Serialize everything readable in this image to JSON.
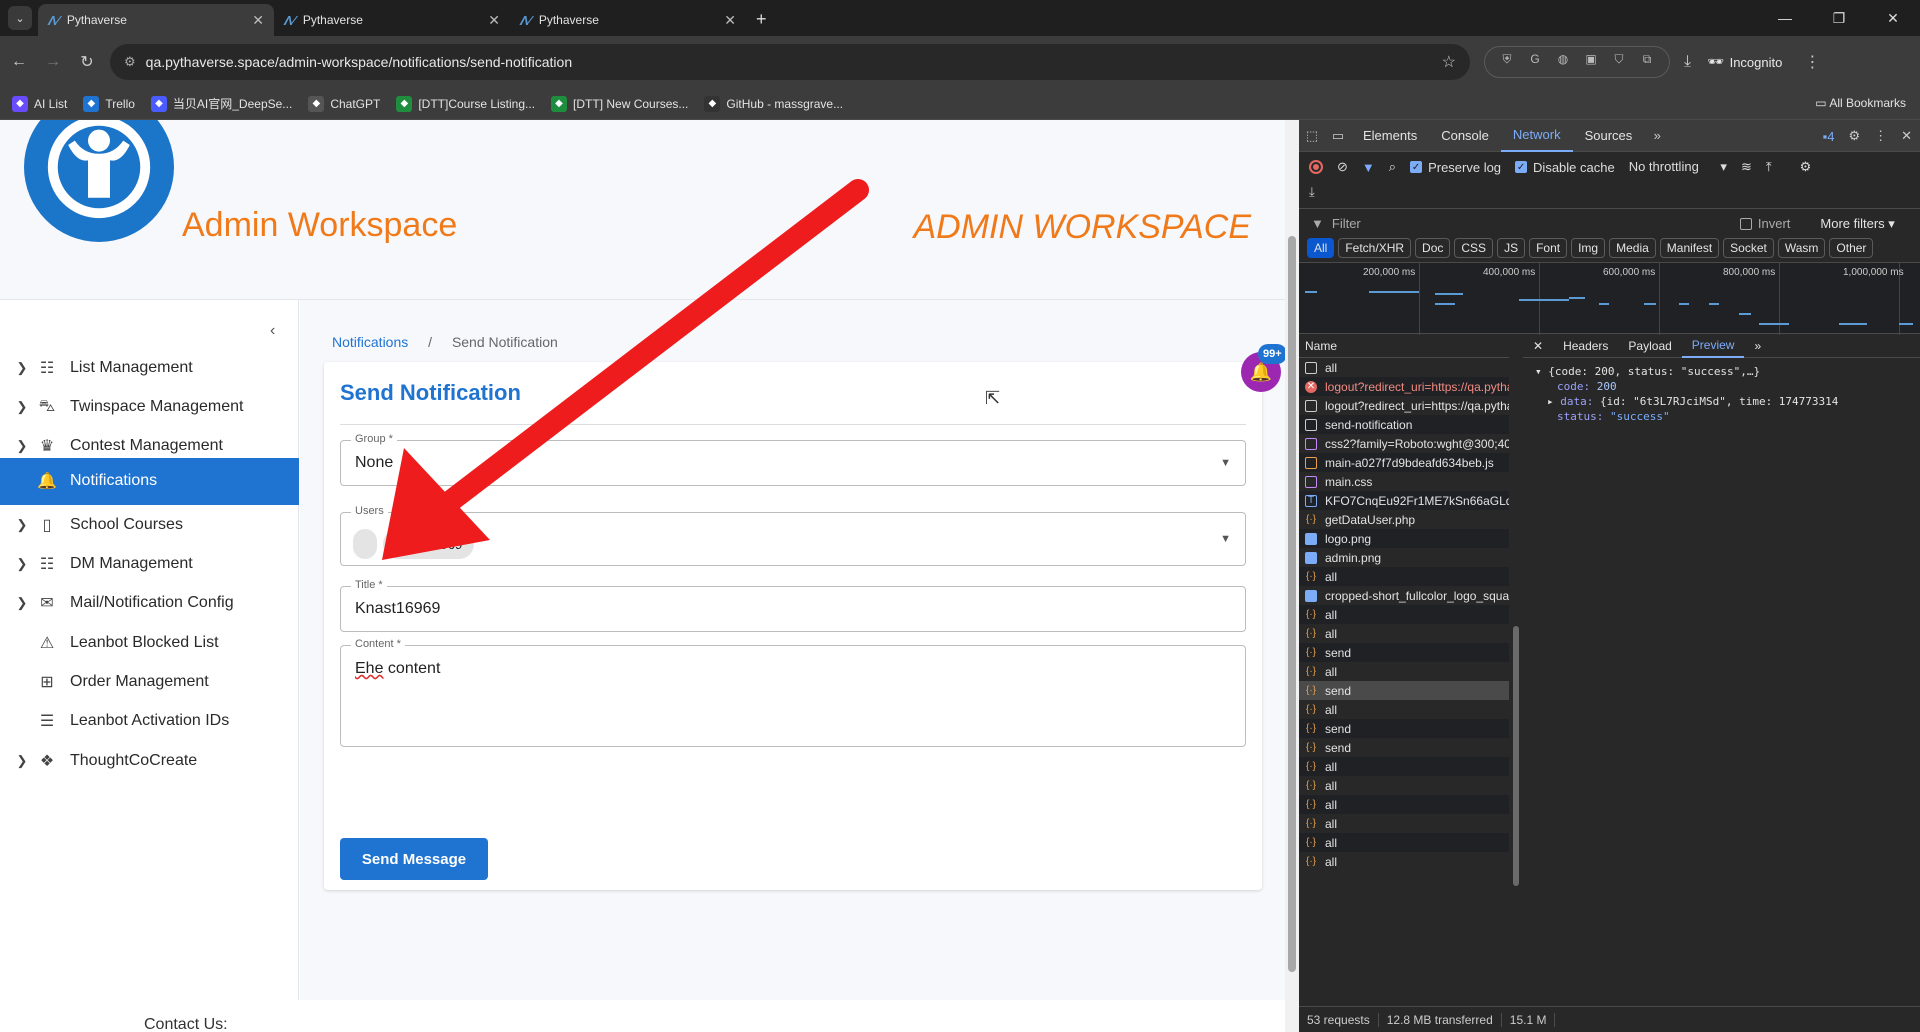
{
  "browser": {
    "tabs": [
      {
        "title": "Pythaverse",
        "active": true
      },
      {
        "title": "Pythaverse",
        "active": false
      },
      {
        "title": "Pythaverse",
        "active": false
      }
    ],
    "url": "qa.pythaverse.space/admin-workspace/notifications/send-notification",
    "incognito_label": "Incognito",
    "bookmarks": [
      {
        "label": "AI List",
        "color": "#6a4cff"
      },
      {
        "label": "Trello",
        "color": "#1f74d2"
      },
      {
        "label": "当贝AI官网_DeepSe...",
        "color": "#4a5cff"
      },
      {
        "label": "ChatGPT",
        "color": "#555555"
      },
      {
        "label": "[DTT]Course Listing...",
        "color": "#1e8e3e"
      },
      {
        "label": "[DTT] New Courses...",
        "color": "#1e8e3e"
      },
      {
        "label": "GitHub - massgrave...",
        "color": "#333333"
      }
    ],
    "all_bookmarks": "All Bookmarks"
  },
  "header": {
    "brand": "Admin Workspace",
    "banner": "ADMIN WORKSPACE"
  },
  "sidebar": {
    "items": [
      {
        "label": "List Management",
        "icon": "list-icon",
        "glyph": "☷",
        "has_children": true,
        "active": false
      },
      {
        "label": "Twinspace Management",
        "icon": "car-icon",
        "glyph": "⛍",
        "has_children": true,
        "active": false
      },
      {
        "label": "Contest Management",
        "icon": "trophy-icon",
        "glyph": "♛",
        "has_children": true,
        "active": false
      },
      {
        "label": "Notifications",
        "icon": "bell-icon",
        "glyph": "🔔",
        "has_children": false,
        "active": true
      },
      {
        "label": "School Courses",
        "icon": "book-icon",
        "glyph": "▯",
        "has_children": true,
        "active": false
      },
      {
        "label": "DM Management",
        "icon": "list-icon",
        "glyph": "☷",
        "has_children": true,
        "active": false
      },
      {
        "label": "Mail/Notification Config",
        "icon": "mail-icon",
        "glyph": "✉",
        "has_children": true,
        "active": false
      },
      {
        "label": "Leanbot Blocked List",
        "icon": "cone-icon",
        "glyph": "⚠",
        "has_children": false,
        "active": false
      },
      {
        "label": "Order Management",
        "icon": "basket-icon",
        "glyph": "⊞",
        "has_children": false,
        "active": false
      },
      {
        "label": "Leanbot Activation IDs",
        "icon": "checklist-icon",
        "glyph": "☰",
        "has_children": false,
        "active": false
      },
      {
        "label": "ThoughtCoCreate",
        "icon": "cubes-icon",
        "glyph": "❖",
        "has_children": true,
        "active": false
      }
    ]
  },
  "breadcrumb": {
    "parent": "Notifications",
    "separator": "/",
    "current": "Send Notification"
  },
  "form": {
    "title": "Send Notification",
    "group_label": "Group *",
    "group_value": "None",
    "users_label": "Users",
    "user_chip": "knast16969",
    "title_label": "Title *",
    "title_value": "Knast16969",
    "content_label": "Content *",
    "content_word1": "Ehe",
    "content_rest": " content",
    "send_button": "Send Message"
  },
  "notifications_badge": "99+",
  "footer": {
    "contact": "Contact Us:"
  },
  "devtools": {
    "tabs": [
      "Elements",
      "Console",
      "Network",
      "Sources"
    ],
    "active_tab": "Network",
    "issues_count": "4",
    "preserve_log": "Preserve log",
    "disable_cache": "Disable cache",
    "throttling": "No throttling",
    "filter_placeholder": "Filter",
    "invert": "Invert",
    "more_filters": "More filters",
    "filter_types": [
      "All",
      "Fetch/XHR",
      "Doc",
      "CSS",
      "JS",
      "Font",
      "Img",
      "Media",
      "Manifest",
      "Socket",
      "Wasm",
      "Other"
    ],
    "timeline_ticks": [
      "200,000 ms",
      "400,000 ms",
      "600,000 ms",
      "800,000 ms",
      "1,000,000 ms"
    ],
    "name_header": "Name",
    "requests": [
      {
        "name": "all",
        "type": "doc"
      },
      {
        "name": "logout?redirect_uri=https://qa.pythav...",
        "type": "err"
      },
      {
        "name": "logout?redirect_uri=https://qa.pythav...",
        "type": "doc"
      },
      {
        "name": "send-notification",
        "type": "doc"
      },
      {
        "name": "css2?family=Roboto:wght@300;400;5...",
        "type": "css"
      },
      {
        "name": "main-a027f7d9bdeafd634beb.js",
        "type": "js"
      },
      {
        "name": "main.css",
        "type": "css"
      },
      {
        "name": "KFO7CnqEu92Fr1ME7kSn66aGLdTylU...",
        "type": "font"
      },
      {
        "name": "getDataUser.php",
        "type": "xhr"
      },
      {
        "name": "logo.png",
        "type": "img"
      },
      {
        "name": "admin.png",
        "type": "img"
      },
      {
        "name": "all",
        "type": "xhr"
      },
      {
        "name": "cropped-short_fullcolor_logo_square-...",
        "type": "img"
      },
      {
        "name": "all",
        "type": "xhr"
      },
      {
        "name": "all",
        "type": "xhr"
      },
      {
        "name": "send",
        "type": "xhr"
      },
      {
        "name": "all",
        "type": "xhr"
      },
      {
        "name": "send",
        "type": "xhr",
        "selected": true
      },
      {
        "name": "all",
        "type": "xhr"
      },
      {
        "name": "send",
        "type": "xhr"
      },
      {
        "name": "send",
        "type": "xhr"
      },
      {
        "name": "all",
        "type": "xhr"
      },
      {
        "name": "all",
        "type": "xhr"
      },
      {
        "name": "all",
        "type": "xhr"
      },
      {
        "name": "all",
        "type": "xhr"
      },
      {
        "name": "all",
        "type": "xhr"
      },
      {
        "name": "all",
        "type": "xhr"
      }
    ],
    "detail_tabs": [
      "Headers",
      "Payload",
      "Preview"
    ],
    "active_detail_tab": "Preview",
    "preview": {
      "summary": "{code: 200, status: \"success\",…}",
      "code_key": "code:",
      "code_val": "200",
      "data_key": "data:",
      "data_val": "{id: \"6t3L7RJciMSd\", time: 174773314",
      "status_key": "status:",
      "status_val": "\"success\""
    },
    "status_bar": [
      "53 requests",
      "12.8 MB transferred",
      "15.1 M"
    ]
  }
}
